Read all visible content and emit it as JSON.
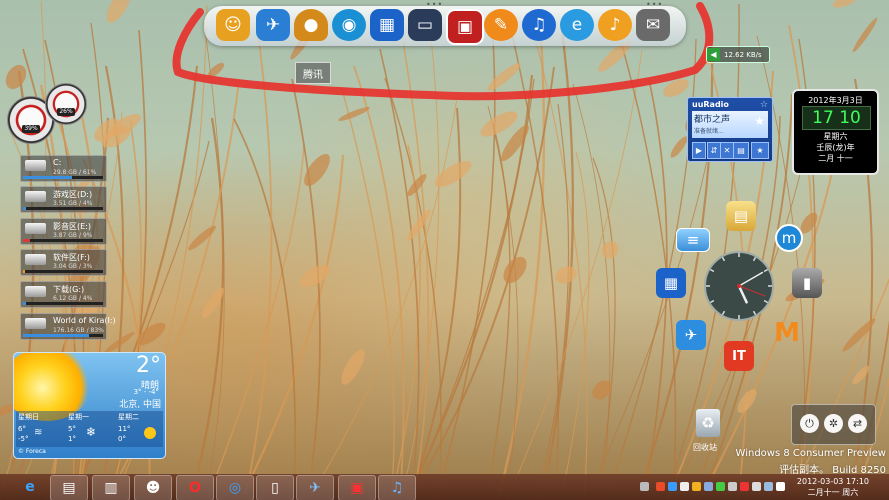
{
  "dock": {
    "apps": [
      {
        "name": "Tencent Security",
        "icon": "tiger-face-icon"
      },
      {
        "name": "Feishu",
        "icon": "blue-bird-icon"
      },
      {
        "name": "Mushroom",
        "icon": "mushroom-icon"
      },
      {
        "name": "Browser",
        "icon": "magnifier-icon"
      },
      {
        "name": "Windows Tiles",
        "icon": "tiles-icon"
      },
      {
        "name": "My Computer",
        "icon": "monitor-icon"
      },
      {
        "name": "Film",
        "icon": "film-frame-icon"
      },
      {
        "name": "QQ Pinyin",
        "icon": "chat-bubble-icon"
      },
      {
        "name": "iTunes",
        "icon": "music-note-icon"
      },
      {
        "name": "Internet Explorer",
        "icon": "ie-icon"
      },
      {
        "name": "Media Player",
        "icon": "headphones-icon"
      },
      {
        "name": "Mail",
        "icon": "envelope-icon"
      }
    ],
    "tooltip": "腾讯"
  },
  "net_speed": "12.62 KB/s",
  "gauges": [
    {
      "value": "39%"
    },
    {
      "value": "26%"
    }
  ],
  "drives": [
    {
      "name": "C:",
      "size": "29.8 GB / 61%",
      "fill": 0.61,
      "color": "#3b8fe0"
    },
    {
      "name": "游戏区(D:)",
      "size": "3.51 GB / 4%",
      "fill": 0.04,
      "color": "#3b8fe0"
    },
    {
      "name": "影音区(E:)",
      "size": "3.87 GB / 9%",
      "fill": 0.09,
      "color": "#d63a3a"
    },
    {
      "name": "软件区(F:)",
      "size": "3.04 GB / 3%",
      "fill": 0.03,
      "color": "#f09a20"
    },
    {
      "name": "下载(G:)",
      "size": "6.12 GB / 4%",
      "fill": 0.04,
      "color": "#3b8fe0"
    },
    {
      "name": "World of Kira(I:)",
      "size": "176.16 GB / 83%",
      "fill": 0.83,
      "color": "#3b8fe0"
    }
  ],
  "weather": {
    "temp": "2°",
    "condition": "晴朗",
    "range": "3° - -4°",
    "location": "北京, 中国",
    "days": [
      {
        "day": "星期日",
        "high": "6°",
        "low": "-5°"
      },
      {
        "day": "星期一",
        "high": "5°",
        "low": "1°"
      },
      {
        "day": "星期二",
        "high": "11°",
        "low": "0°"
      }
    ],
    "brand": "© Foreca"
  },
  "radio": {
    "logo": "uuRadio",
    "station": "都市之声",
    "status": "准备就绪..."
  },
  "date_widget": {
    "date": "2012年3月3日",
    "time": "17 10",
    "weekday": "星期六",
    "lunar_year": "壬辰(龙)年",
    "lunar_day": "二月 十一"
  },
  "desktop_icons": [
    {
      "name": "folder",
      "icon": "folder-icon"
    },
    {
      "name": "maxthon",
      "icon": "maxthon-icon"
    },
    {
      "name": "network",
      "icon": "network-card-icon"
    },
    {
      "name": "tiles",
      "icon": "tiles-icon"
    },
    {
      "name": "computer",
      "icon": "computer-icon"
    },
    {
      "name": "feishu",
      "icon": "blue-bird-icon"
    },
    {
      "name": "ithome",
      "icon": "ithome-icon"
    },
    {
      "name": "mtool",
      "icon": "m-logo-icon"
    },
    {
      "name": "recycle",
      "icon": "recycle-bin-icon"
    }
  ],
  "recycle_label": "回收站",
  "clock_widget": {
    "hour": 5,
    "minute": 10
  },
  "watermark": {
    "line1": "Windows 8 Consumer Preview",
    "line2": "评估副本。 Build 8250"
  },
  "taskbar": {
    "buttons": [
      {
        "name": "ie",
        "icon": "ie-icon",
        "active": false
      },
      {
        "name": "explorer",
        "icon": "folder-icon",
        "active": true
      },
      {
        "name": "library",
        "icon": "books-icon",
        "active": true
      },
      {
        "name": "qq",
        "icon": "penguin-icon",
        "active": true
      },
      {
        "name": "opera",
        "icon": "opera-icon",
        "active": true
      },
      {
        "name": "maxthon",
        "icon": "maxthon-icon",
        "active": true
      },
      {
        "name": "document",
        "icon": "document-icon",
        "active": true
      },
      {
        "name": "feishu",
        "icon": "blue-bird-icon",
        "active": true
      },
      {
        "name": "film",
        "icon": "film-frame-icon",
        "active": true
      },
      {
        "name": "itunes",
        "icon": "music-note-icon",
        "active": true
      }
    ],
    "clock_date": "2012-03-03 17:10",
    "clock_lunar": "二月十一 周六"
  },
  "colors": {
    "annotation": "#e8302a",
    "dock_bg": "#dfe5ea",
    "radio": "#1f4fa8"
  }
}
